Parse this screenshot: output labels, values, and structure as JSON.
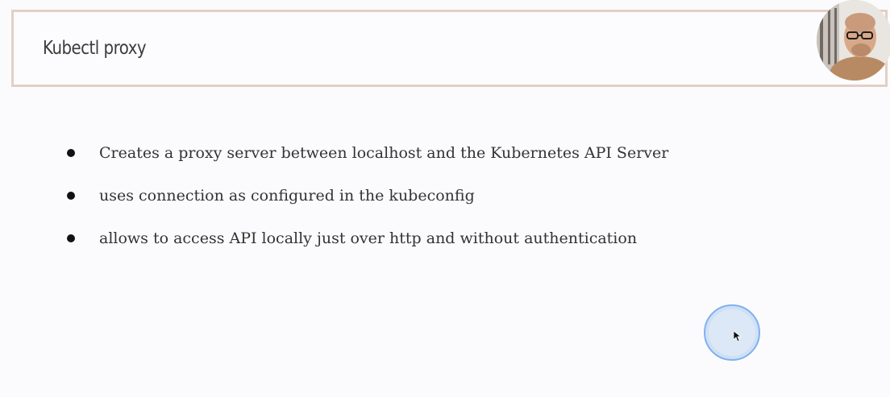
{
  "slide": {
    "title": "Kubectl proxy",
    "bullets": [
      "Creates a proxy server between localhost and the Kubernetes API Server",
      "uses connection as configured in the kubeconfig",
      "allows to access API locally just over http and without authentication"
    ]
  },
  "colors": {
    "title_border": "#e4cfc6",
    "background": "#fbfbfd",
    "text": "#333333",
    "cursor_ring": "#7fb1ee"
  },
  "icons": {
    "cursor": "mouse-pointer-icon",
    "webcam": "presenter-webcam"
  }
}
